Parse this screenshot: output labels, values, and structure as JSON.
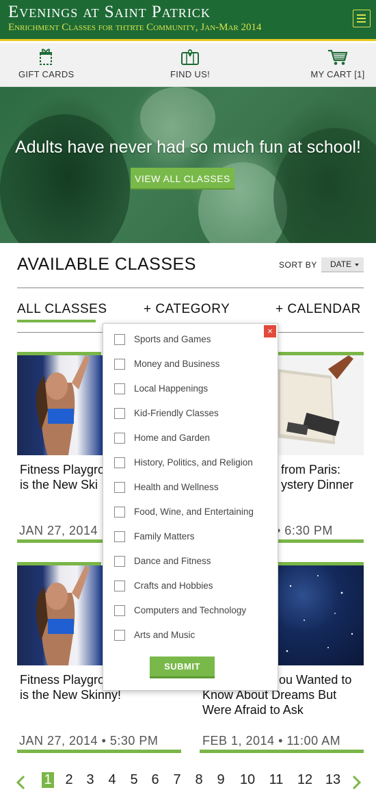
{
  "header": {
    "title": "Evenings at Saint Patrick",
    "subtitle": "Enrichment Classes for thtrte Community, Jan-Mar 2014"
  },
  "toolbar": {
    "gift_cards": "GIFT CARDS",
    "find_us": "FIND US!",
    "my_cart": "MY CART [1]"
  },
  "hero": {
    "headline": "Adults have never had so much fun at school!",
    "button": "VIEW ALL CLASSES"
  },
  "classes": {
    "title": "AVAILABLE CLASSES",
    "sort_label": "SORT BY",
    "sort_value": "DATE",
    "tabs": [
      "ALL CLASSES",
      "+ CATEGORY",
      "+ CALENDAR"
    ]
  },
  "cards": [
    {
      "title_line1": "Fitness Playgro",
      "title_line2": "is the New Ski",
      "date": "JAN 27, 2014"
    },
    {
      "title_line1": "from Paris:",
      "title_line2": "ystery Dinner",
      "date": "• 6:30 PM"
    },
    {
      "title_line1": "Fitness Playgro",
      "title_line2": "is the New Skinny!",
      "date": "JAN 27, 2014  •  5:30 PM"
    },
    {
      "title_line1": "ou Wanted to",
      "title_line2": "Know About Dreams But",
      "title_line3": "Were Afraid to Ask",
      "date": "FEB 1, 2014  •  11:00 AM"
    }
  ],
  "category_dropdown": {
    "close": "×",
    "options": [
      "Sports and Games",
      "Money and Business",
      "Local Happenings",
      "Kid-Friendly Classes",
      "Home and Garden",
      "History, Politics, and Religion",
      "Health and Wellness",
      "Food, Wine, and Entertaining",
      "Family Matters",
      "Dance and Fitness",
      "Crafts and Hobbies",
      "Computers and Technology",
      "Arts and Music"
    ],
    "submit": "SUBMIT"
  },
  "pagination": {
    "pages": [
      "1",
      "2",
      "3",
      "4",
      "5",
      "6",
      "7",
      "8",
      "9",
      "10",
      "11",
      "12",
      "13"
    ],
    "current": "1"
  },
  "colors": {
    "brand_green": "#1e6a35",
    "accent_green": "#7ab648",
    "header_gold": "#e8c91e",
    "close_red": "#e24a3b"
  }
}
